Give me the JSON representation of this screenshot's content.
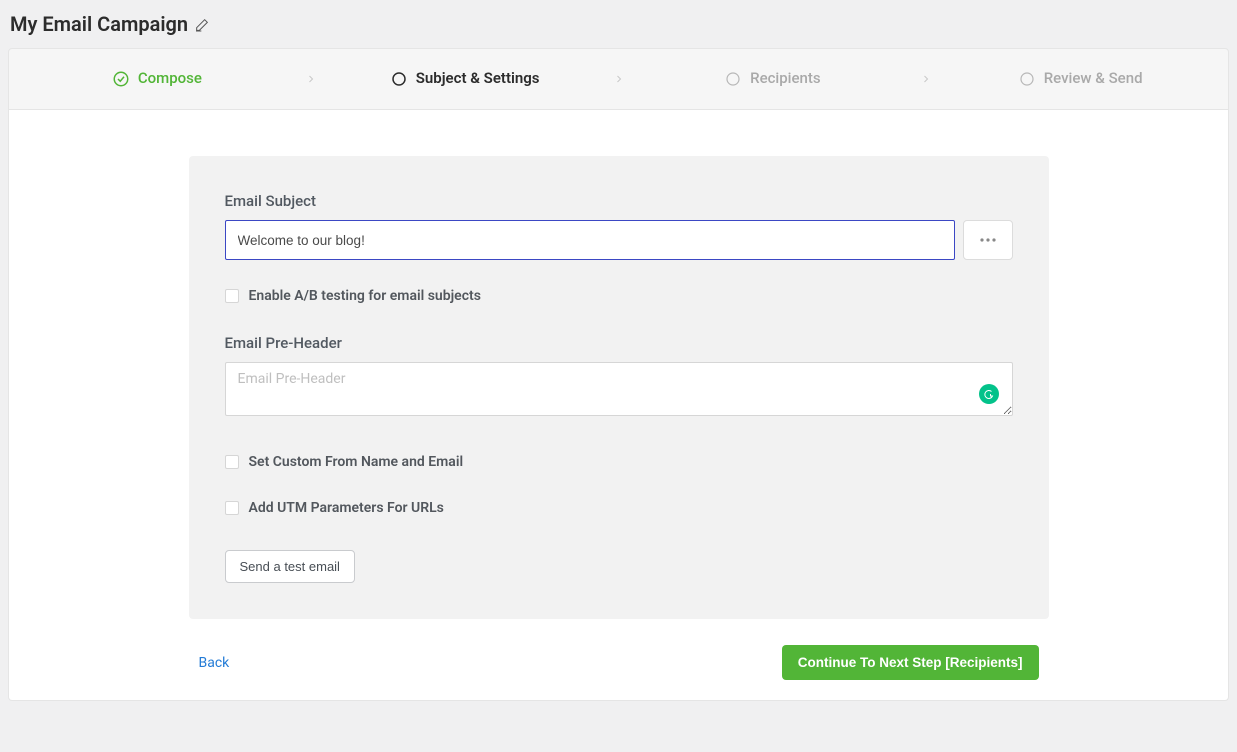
{
  "header": {
    "title": "My Email Campaign"
  },
  "steps": {
    "compose": "Compose",
    "subject": "Subject & Settings",
    "recipients": "Recipients",
    "review": "Review & Send"
  },
  "form": {
    "subject_label": "Email Subject",
    "subject_value": "Welcome to our blog!",
    "ab_label": "Enable A/B testing for email subjects",
    "preheader_label": "Email Pre-Header",
    "preheader_placeholder": "Email Pre-Header",
    "custom_from_label": "Set Custom From Name and Email",
    "utm_label": "Add UTM Parameters For URLs",
    "test_button": "Send a test email"
  },
  "footer": {
    "back": "Back",
    "next": "Continue To Next Step [Recipients]"
  }
}
